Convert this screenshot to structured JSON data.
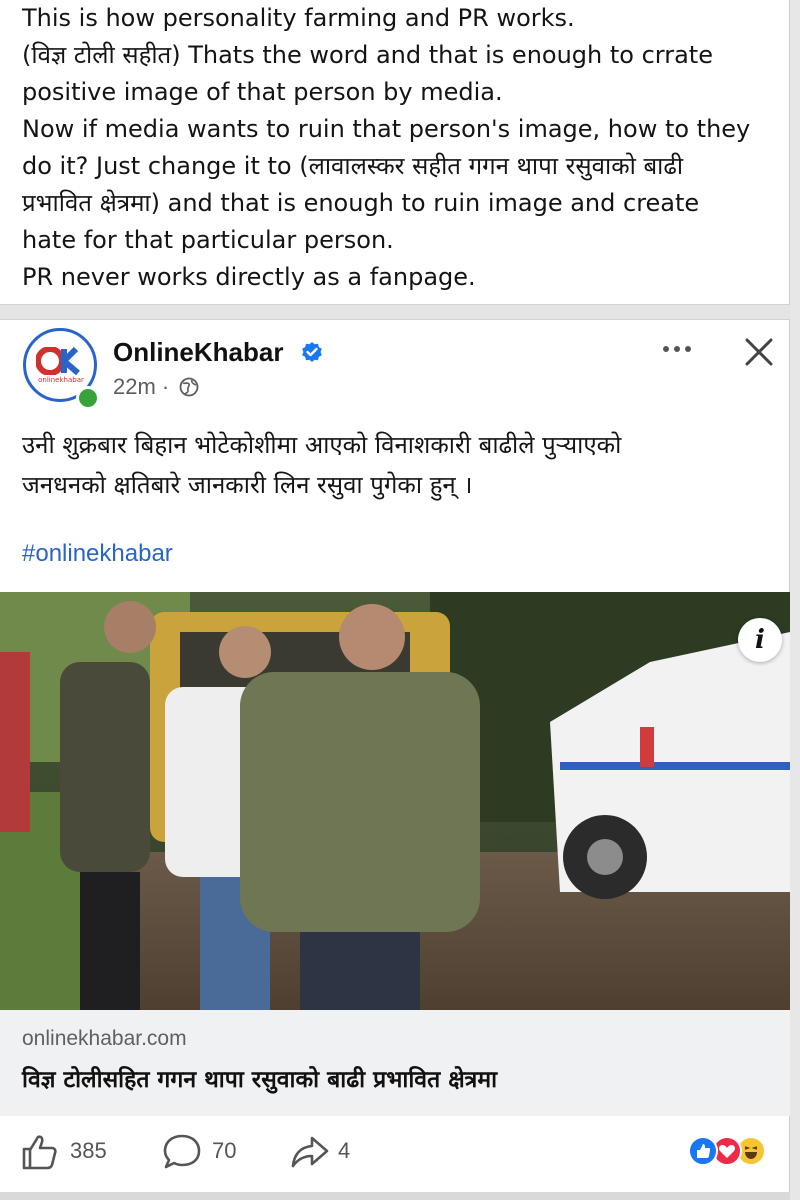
{
  "comment": {
    "lines": [
      "This is how personality farming and PR works.",
      "(विज्ञ टोली सहीत) Thats the word and that is enough to crrate",
      "positive image of that person by media.",
      "Now if media wants to ruin that person's image, how to they",
      "do it? Just change it to (लावालस्कर सहीत गगन थापा रसुवाको बाढी",
      "प्रभावित क्षेत्रमा) and that is enough to ruin image and create",
      "hate for that particular person.",
      "PR never works directly as a fanpage."
    ]
  },
  "post": {
    "avatar_logo": "OK",
    "avatar_subtext": "onlinekhabar",
    "page_name": "OnlineKhabar",
    "time": "22m",
    "separator": "·",
    "text_lines": [
      "उनी शुक्रबार बिहान भोटेकोशीमा आएको विनाशकारी बाढीले पुर्‍याएको",
      "जनधनको क्षतिबारे जानकारी लिन रसुवा पुगेका हुन् ।"
    ],
    "hashtag": "#onlinekhabar",
    "info_glyph": "i",
    "link": {
      "domain": "onlinekhabar.com",
      "title": "विज्ञ टोलीसहित गगन थापा रसुवाको बाढी प्रभावित क्षेत्रमा"
    },
    "actions": {
      "likes": "385",
      "comments": "70",
      "shares": "4"
    },
    "reactions": [
      "like-icon",
      "love-icon",
      "haha-icon"
    ],
    "icons": {
      "verified": "verified-badge-icon",
      "globe": "globe-icon",
      "more": "more-options-icon",
      "close": "close-icon",
      "like": "thumbs-up-icon",
      "comment": "comment-bubble-icon",
      "share": "share-arrow-icon"
    },
    "colors": {
      "brand_blue": "#2a64c8",
      "brand_red": "#d0312d",
      "online_green": "#38a33a"
    }
  }
}
